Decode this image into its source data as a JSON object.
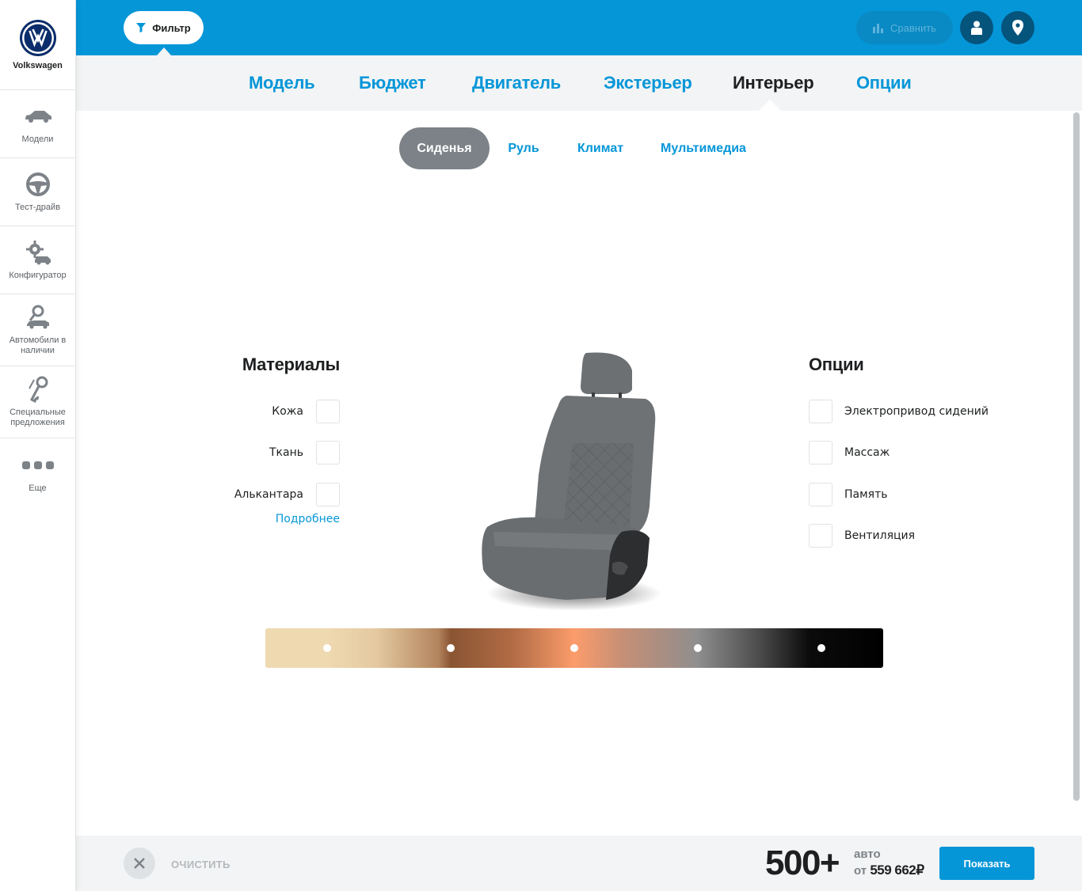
{
  "brand": {
    "name": "Volkswagen"
  },
  "sidebar": {
    "items": [
      {
        "label": "Модели",
        "icon": "car-icon"
      },
      {
        "label": "Тест-драйв",
        "icon": "steering-wheel-icon"
      },
      {
        "label": "Конфигуратор",
        "icon": "configurator-gear-car-icon"
      },
      {
        "label": "Автомобили в наличии",
        "icon": "car-search-icon"
      },
      {
        "label": "Специальные предложения",
        "icon": "key-icon"
      },
      {
        "label": "Еще",
        "icon": "more-dots-icon"
      }
    ]
  },
  "topbar": {
    "filter_label": "Фильтр",
    "compare_label": "Сравнить",
    "accent_color": "#0596d8"
  },
  "categories": {
    "tabs": [
      "Модель",
      "Бюджет",
      "Двигатель",
      "Экстерьер",
      "Интерьер",
      "Опции"
    ],
    "active": "Интерьер"
  },
  "subtabs": {
    "tabs": [
      "Сиденья",
      "Руль",
      "Климат",
      "Мультимедиа"
    ],
    "active": "Сиденья"
  },
  "materials": {
    "title": "Материалы",
    "items": [
      "Кожа",
      "Ткань",
      "Алькантара"
    ],
    "more_link": "Подробнее"
  },
  "options": {
    "title": "Опции",
    "items": [
      "Электропривод сидений",
      "Массаж",
      "Память",
      "Вентиляция"
    ]
  },
  "colors": {
    "swatches": [
      "#efd9b1",
      "#8a5533",
      "#fb9c6b",
      "#8f8e8e",
      "#000000"
    ]
  },
  "bottom": {
    "clear_label": "ОЧИСТИТЬ",
    "count": "500+",
    "count_unit": "авто",
    "price_prefix": "от",
    "price": "559 662₽",
    "show_label": "Показать"
  }
}
